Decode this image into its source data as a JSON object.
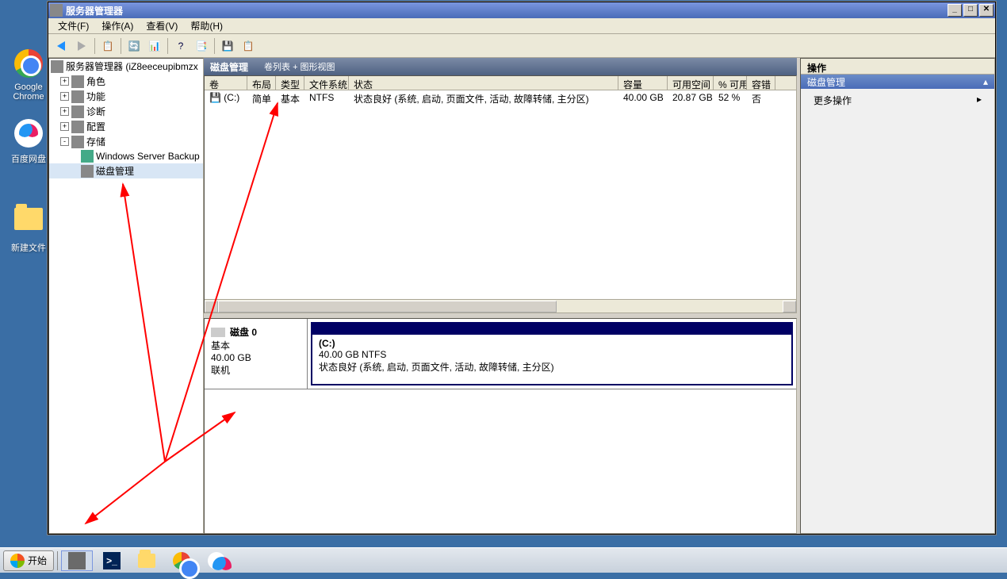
{
  "desktop": {
    "icons": [
      {
        "label": "Google Chrome",
        "type": "chrome"
      },
      {
        "label": "百度网盘",
        "type": "baidu"
      },
      {
        "label": "新建文件",
        "type": "folder"
      }
    ]
  },
  "window": {
    "title": "服务器管理器",
    "menu": {
      "file": "文件(F)",
      "action": "操作(A)",
      "view": "查看(V)",
      "help": "帮助(H)"
    },
    "tree": {
      "root": "服务器管理器 (iZ8eeceupibmzx",
      "nodes": {
        "roles": "角色",
        "features": "功能",
        "diagnostics": "诊断",
        "config": "配置",
        "storage": "存储",
        "wsb": "Windows Server Backup",
        "disk_mgmt": "磁盘管理"
      }
    },
    "main_header": {
      "title": "磁盘管理",
      "subtitle": "卷列表 + 图形视图"
    },
    "volume_table": {
      "columns": {
        "vol": "卷",
        "layout": "布局",
        "type": "类型",
        "fs": "文件系统",
        "status": "状态",
        "capacity": "容量",
        "free": "可用空间",
        "pct": "% 可用",
        "fault": "容错"
      },
      "row": {
        "vol": "(C:)",
        "layout": "简单",
        "type": "基本",
        "fs": "NTFS",
        "status": "状态良好 (系统, 启动, 页面文件, 活动, 故障转储, 主分区)",
        "capacity": "40.00 GB",
        "free": "20.87 GB",
        "pct": "52 %",
        "fault": "否"
      }
    },
    "disk_panel": {
      "disk_name": "磁盘 0",
      "disk_type": "基本",
      "disk_size": "40.00 GB",
      "disk_status": "联机",
      "partition": {
        "label": "(C:)",
        "info": "40.00 GB NTFS",
        "status": "状态良好 (系统, 启动, 页面文件, 活动, 故障转储, 主分区)"
      }
    },
    "actions": {
      "header": "操作",
      "section": "磁盘管理",
      "more": "更多操作"
    }
  },
  "taskbar": {
    "start": "开始"
  }
}
